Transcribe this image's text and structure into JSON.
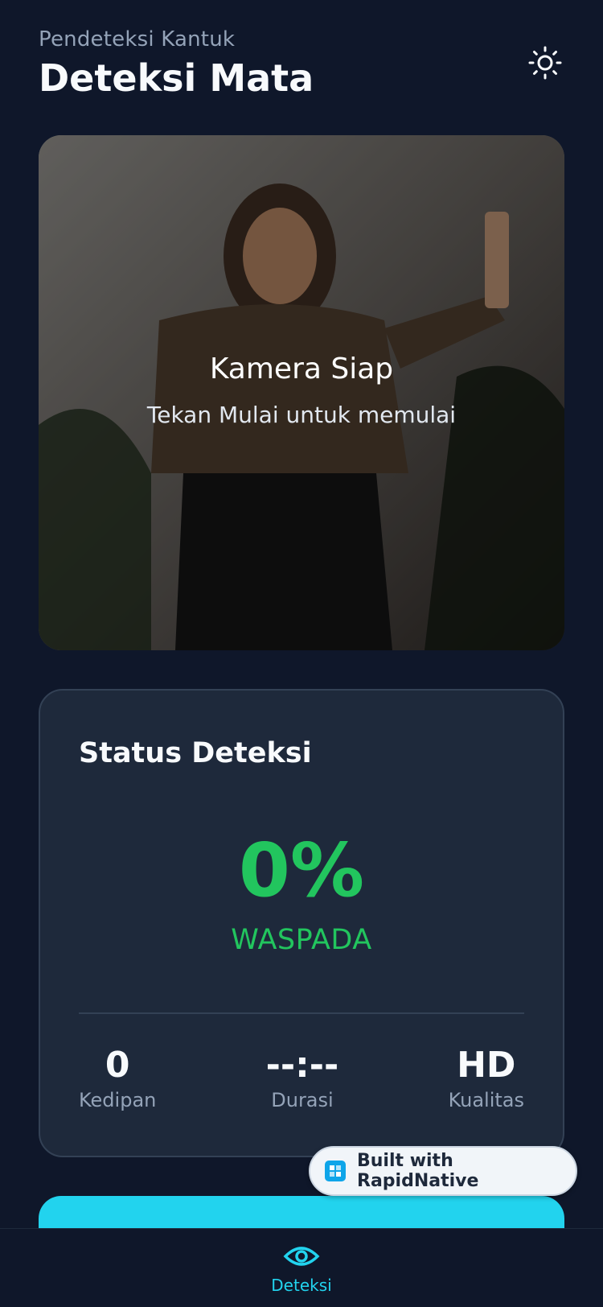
{
  "header": {
    "subtitle": "Pendeteksi Kantuk",
    "title": "Deteksi Mata",
    "theme_icon": "sun-icon"
  },
  "camera": {
    "title": "Kamera Siap",
    "subtitle": "Tekan Mulai untuk memulai"
  },
  "status": {
    "title": "Status Deteksi",
    "percent": "0%",
    "state": "WASPADA",
    "stats": [
      {
        "value": "0",
        "label": "Kedipan"
      },
      {
        "value": "--:--",
        "label": "Durasi"
      },
      {
        "value": "HD",
        "label": "Kualitas"
      }
    ]
  },
  "badge": {
    "text": "Built with RapidNative"
  },
  "tabbar": {
    "active_label": "Deteksi",
    "icon": "eye-icon"
  },
  "colors": {
    "background": "#0f172a",
    "card": "#1e293b",
    "accent": "#22d3ee",
    "alert_ok": "#22c55e"
  }
}
